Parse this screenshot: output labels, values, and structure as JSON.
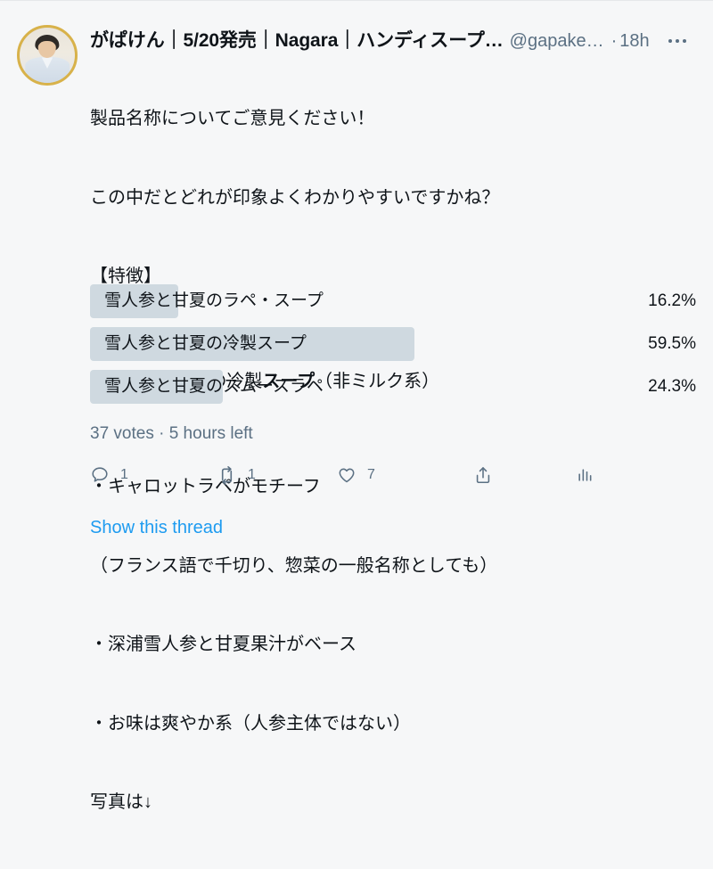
{
  "tweet": {
    "author": {
      "display_name": "がぱけん｜5/20発売｜Nagara｜ハンディスープ…",
      "handle": "@gapake…",
      "avatar_alt": "avatar-photo"
    },
    "timestamp": "18h",
    "separator": "·",
    "more_menu_label": "more-options",
    "body_lines": [
      "製品名称についてご意見ください！",
      "この中だとどれが印象よくわかりやすいですかね？",
      "【特徴】",
      "・トロトロの冷製スープ（非ミルク系）",
      "・キャロットラペがモチーフ",
      "（フランス語で千切り、惣菜の一般名称としても）",
      "・深浦雪人参と甘夏果汁がベース",
      "・お味は爽やか系（人参主体ではない）",
      "写真は↓"
    ],
    "body_bold_fragment": "スープ"
  },
  "poll": {
    "options": [
      {
        "label": "雪人参と甘夏のラペ・スープ",
        "percent": "16.2%",
        "value": 16.2
      },
      {
        "label": "雪人参と甘夏の冷製スープ",
        "percent": "59.5%",
        "value": 59.5
      },
      {
        "label": "雪人参と甘夏のスムースラペ",
        "percent": "24.3%",
        "value": 24.3
      }
    ],
    "meta": "37 votes · 5 hours left",
    "votes_count": "37 votes",
    "time_left": "5 hours left",
    "bar_color": "#cfd9e0"
  },
  "actions": {
    "reply": {
      "icon": "reply-icon",
      "count": "1"
    },
    "retweet": {
      "icon": "retweet-icon",
      "count": "1"
    },
    "like": {
      "icon": "heart-icon",
      "count": "7"
    },
    "share": {
      "icon": "share-icon",
      "count": ""
    },
    "analytics": {
      "icon": "analytics-icon",
      "count": ""
    }
  },
  "footer": {
    "show_thread": "Show this thread",
    "link_color": "#1d9bf0"
  },
  "colors": {
    "background": "#f6f7f8",
    "text": "#0f1419",
    "muted": "#5b7083",
    "accent": "#1d9bf0",
    "poll_bar": "#cfd9e0"
  }
}
